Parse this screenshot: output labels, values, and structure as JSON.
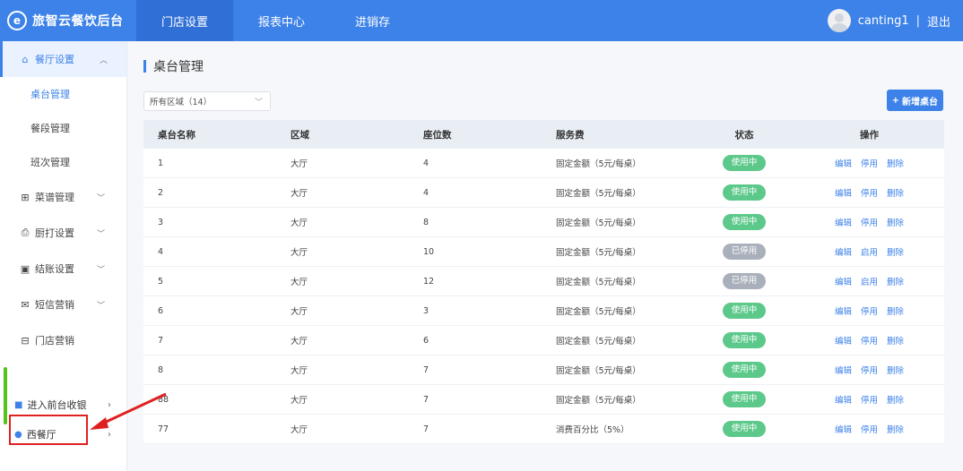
{
  "brand": {
    "logo_glyph": "e",
    "title": "旅智云餐饮后台"
  },
  "nav": [
    {
      "label": "门店设置",
      "active": true
    },
    {
      "label": "报表中心",
      "active": false
    },
    {
      "label": "进销存",
      "active": false
    }
  ],
  "user": {
    "name": "canting1",
    "separator": "|",
    "logout": "退出"
  },
  "sidebar": {
    "restaurant_settings": "餐厅设置",
    "sub_items": [
      "桌台管理",
      "餐段管理",
      "班次管理"
    ],
    "groups": [
      "菜谱管理",
      "厨打设置",
      "结账设置",
      "短信营销",
      "门店营销"
    ],
    "bottom": {
      "front_cashier": "进入前台收银",
      "store": "西餐厅"
    }
  },
  "main": {
    "title": "桌台管理",
    "area_filter": "所有区域（14）",
    "add_button": "新增桌台",
    "columns": [
      "桌台名称",
      "区域",
      "座位数",
      "服务费",
      "状态",
      "操作"
    ],
    "rows": [
      {
        "name": "1",
        "area": "大厅",
        "seats": "4",
        "fee": "固定金额（5元/每桌）",
        "status": "使用中",
        "on": true,
        "ops": [
          "编辑",
          "停用",
          "删除"
        ]
      },
      {
        "name": "2",
        "area": "大厅",
        "seats": "4",
        "fee": "固定金额（5元/每桌）",
        "status": "使用中",
        "on": true,
        "ops": [
          "编辑",
          "停用",
          "删除"
        ]
      },
      {
        "name": "3",
        "area": "大厅",
        "seats": "8",
        "fee": "固定金额（5元/每桌）",
        "status": "使用中",
        "on": true,
        "ops": [
          "编辑",
          "停用",
          "删除"
        ]
      },
      {
        "name": "4",
        "area": "大厅",
        "seats": "10",
        "fee": "固定金额（5元/每桌）",
        "status": "已停用",
        "on": false,
        "ops": [
          "编辑",
          "启用",
          "删除"
        ]
      },
      {
        "name": "5",
        "area": "大厅",
        "seats": "12",
        "fee": "固定金额（5元/每桌）",
        "status": "已停用",
        "on": false,
        "ops": [
          "编辑",
          "启用",
          "删除"
        ]
      },
      {
        "name": "6",
        "area": "大厅",
        "seats": "3",
        "fee": "固定金额（5元/每桌）",
        "status": "使用中",
        "on": true,
        "ops": [
          "编辑",
          "停用",
          "删除"
        ]
      },
      {
        "name": "7",
        "area": "大厅",
        "seats": "6",
        "fee": "固定金额（5元/每桌）",
        "status": "使用中",
        "on": true,
        "ops": [
          "编辑",
          "停用",
          "删除"
        ]
      },
      {
        "name": "8",
        "area": "大厅",
        "seats": "7",
        "fee": "固定金额（5元/每桌）",
        "status": "使用中",
        "on": true,
        "ops": [
          "编辑",
          "停用",
          "删除"
        ]
      },
      {
        "name": "88",
        "area": "大厅",
        "seats": "7",
        "fee": "固定金额（5元/每桌）",
        "status": "使用中",
        "on": true,
        "ops": [
          "编辑",
          "停用",
          "删除"
        ]
      },
      {
        "name": "77",
        "area": "大厅",
        "seats": "7",
        "fee": "消费百分比（5%）",
        "status": "使用中",
        "on": true,
        "ops": [
          "编辑",
          "停用",
          "删除"
        ]
      }
    ]
  },
  "colors": {
    "primary": "#3d82e8",
    "active_badge": "#5cc98a",
    "inactive_badge": "#a9b0bb",
    "annotation_red": "#e02020",
    "strip_green": "#52c41a"
  }
}
